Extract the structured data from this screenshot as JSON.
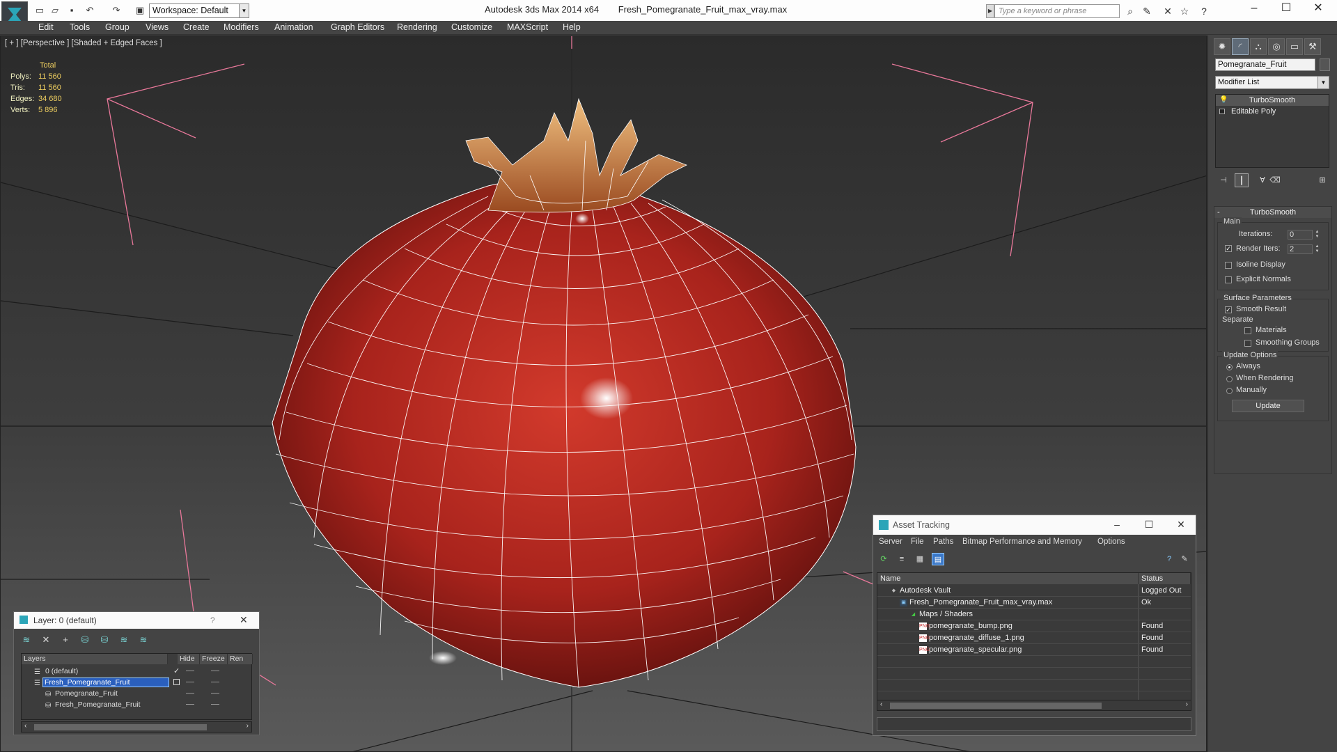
{
  "titlebar": {
    "workspace": "Workspace: Default",
    "app_name": "Autodesk 3ds Max  2014 x64",
    "file_name": "Fresh_Pomegranate_Fruit_max_vray.max",
    "search_placeholder": "Type a keyword or phrase"
  },
  "menu": [
    "Edit",
    "Tools",
    "Group",
    "Views",
    "Create",
    "Modifiers",
    "Animation",
    "Graph Editors",
    "Rendering",
    "Customize",
    "MAXScript",
    "Help"
  ],
  "viewport": {
    "label": "[ + ] [Perspective ] [Shaded + Edged Faces ]",
    "stats": {
      "header": "Total",
      "rows": [
        {
          "label": "Polys:",
          "value": "11 560"
        },
        {
          "label": "Tris:",
          "value": "11 560"
        },
        {
          "label": "Edges:",
          "value": "34 680"
        },
        {
          "label": "Verts:",
          "value": "5 896"
        }
      ]
    }
  },
  "command_panel": {
    "object_name": "Pomegranate_Fruit",
    "modifier_list": "Modifier List",
    "stack": [
      "TurboSmooth",
      "Editable Poly"
    ],
    "turbosmooth": {
      "title": "TurboSmooth",
      "main": "Main",
      "iterations_label": "Iterations:",
      "iterations": "0",
      "render_iters_label": "Render Iters:",
      "render_iters": "2",
      "isoline": "Isoline Display",
      "explicit_normals": "Explicit Normals",
      "surface_params": "Surface Parameters",
      "smooth_result": "Smooth Result",
      "separate": "Separate",
      "materials": "Materials",
      "smoothing_groups": "Smoothing Groups",
      "update_options": "Update Options",
      "always": "Always",
      "when_rendering": "When Rendering",
      "manually": "Manually",
      "update": "Update"
    }
  },
  "layer_dialog": {
    "title": "Layer: 0 (default)",
    "help": "?",
    "columns": [
      "Layers",
      "Hide",
      "Freeze",
      "Ren"
    ],
    "rows": [
      "0 (default)",
      "Fresh_Pomegranate_Fruit",
      "Pomegranate_Fruit",
      "Fresh_Pomegranate_Fruit"
    ]
  },
  "asset_dialog": {
    "title": "Asset Tracking",
    "menu": [
      "Server",
      "File",
      "Paths",
      "Bitmap Performance and Memory",
      "Options"
    ],
    "columns": [
      "Name",
      "Status"
    ],
    "rows": [
      {
        "name": "Autodesk Vault",
        "status": "Logged Out"
      },
      {
        "name": "Fresh_Pomegranate_Fruit_max_vray.max",
        "status": "Ok"
      },
      {
        "name": "Maps / Shaders",
        "status": ""
      },
      {
        "name": "pomegranate_bump.png",
        "status": "Found"
      },
      {
        "name": "pomegranate_diffuse_1.png",
        "status": "Found"
      },
      {
        "name": "pomegranate_specular.png",
        "status": "Found"
      }
    ]
  },
  "colors": {
    "accent": "#2a5fbd",
    "stats": "#f0d060",
    "fruit": "#b0231e",
    "wire": "#ffffff"
  }
}
